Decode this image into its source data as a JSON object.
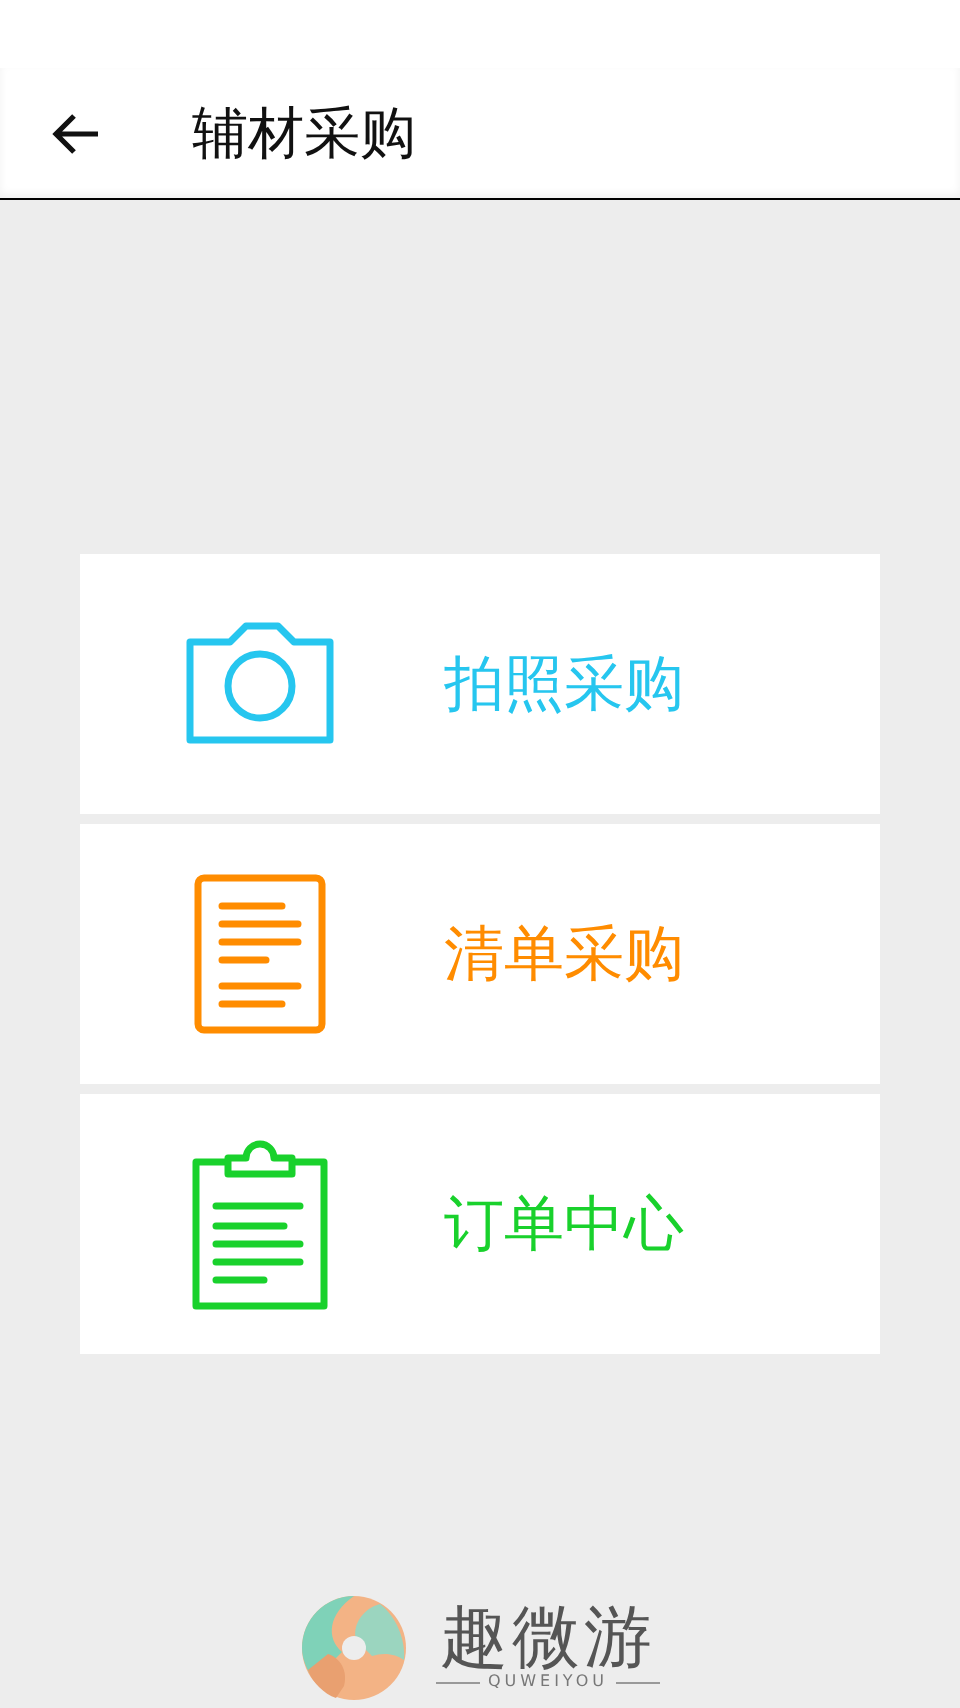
{
  "header": {
    "back_icon": true,
    "title": "辅材采购"
  },
  "menu": [
    {
      "kind": "camera",
      "label": "拍照采购",
      "color": "#26c6ef"
    },
    {
      "kind": "document",
      "label": "清单采购",
      "color": "#ff8c00"
    },
    {
      "kind": "clipboard",
      "label": "订单中心",
      "color": "#19d12c"
    }
  ],
  "footer": {
    "brand": "趣微游",
    "tagline": "QUWEIYOU"
  }
}
